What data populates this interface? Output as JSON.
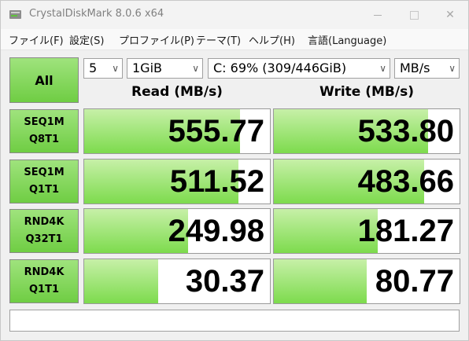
{
  "window": {
    "title": "CrystalDiskMark 8.0.6 x64",
    "accent": "#6fcd43"
  },
  "menu": [
    "ファイル(F)",
    "設定(S)",
    "プロファイル(P)",
    "テーマ(T)",
    "ヘルプ(H)",
    "言語(Language)"
  ],
  "controls": {
    "all_label": "All",
    "count": "5",
    "size": "1GiB",
    "drive": "C: 69% (309/446GiB)",
    "unit": "MB/s"
  },
  "headers": {
    "read": "Read (MB/s)",
    "write": "Write (MB/s)"
  },
  "tests": [
    {
      "line1": "SEQ1M",
      "line2": "Q8T1",
      "read": "555.77",
      "write": "533.80",
      "read_fill": 0.84,
      "write_fill": 0.83
    },
    {
      "line1": "SEQ1M",
      "line2": "Q1T1",
      "read": "511.52",
      "write": "483.66",
      "read_fill": 0.83,
      "write_fill": 0.81
    },
    {
      "line1": "RND4K",
      "line2": "Q32T1",
      "read": "249.98",
      "write": "181.27",
      "read_fill": 0.56,
      "write_fill": 0.56
    },
    {
      "line1": "RND4K",
      "line2": "Q1T1",
      "read": "30.37",
      "write": "80.77",
      "read_fill": 0.4,
      "write_fill": 0.5
    }
  ],
  "comment": ""
}
